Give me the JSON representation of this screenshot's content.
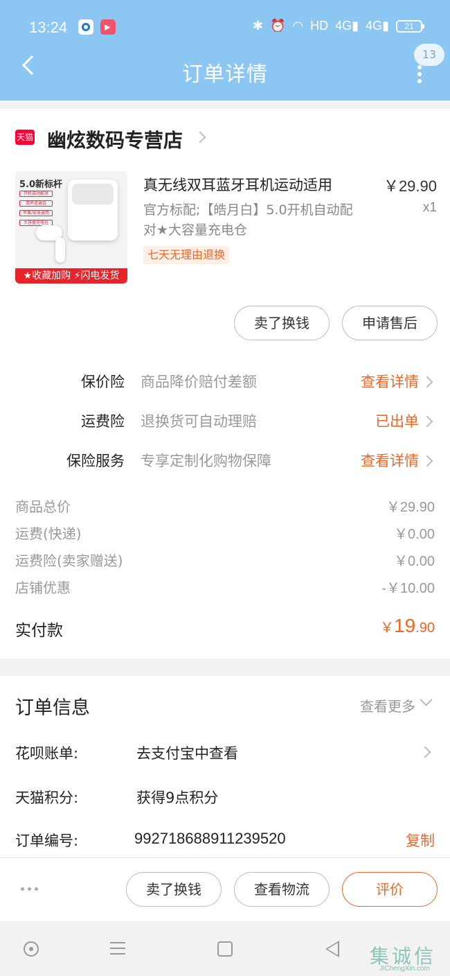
{
  "status_bar": {
    "time": "13:24",
    "network": "HD",
    "signal1": "4G",
    "signal2": "4G",
    "battery": "21"
  },
  "header": {
    "title": "订单详情",
    "badge": "13"
  },
  "store": {
    "tag": "天猫",
    "name": "幽炫数码专营店"
  },
  "product": {
    "image_headline": "5.0新标杆",
    "image_lines": [
      "开机自动配对",
      "双声道通话",
      "苹果/安卓通用",
      "大容量充电仓"
    ],
    "image_banner": "★收藏加购 ⚡闪电发货",
    "title": "真无线双耳蓝牙耳机运动适用",
    "price": "￥29.90",
    "sku": "官方标配;【皓月白】5.0开机自动配对★大容量充电仓",
    "qty": "x1",
    "tag": "七天无理由退换"
  },
  "item_buttons": {
    "sell": "卖了换钱",
    "after_sale": "申请售后"
  },
  "insurance": [
    {
      "name": "保价险",
      "desc": "商品降价赔付差额",
      "action": "查看详情"
    },
    {
      "name": "运费险",
      "desc": "退换货可自动理赔",
      "action": "已出单"
    },
    {
      "name": "保险服务",
      "desc": "专享定制化购物保障",
      "action": "查看详情"
    }
  ],
  "costs": [
    {
      "label": "商品总价",
      "value": "￥29.90"
    },
    {
      "label": "运费(快递)",
      "value": "￥0.00"
    },
    {
      "label": "运费险(卖家赠送)",
      "value": "￥0.00"
    },
    {
      "label": "店铺优惠",
      "value": "-￥10.00"
    }
  ],
  "paid": {
    "label": "实付款",
    "currency": "￥",
    "integer": "19",
    "decimal": ".90"
  },
  "order_info": {
    "title": "订单信息",
    "more": "查看更多",
    "rows": [
      {
        "label": "花呗账单:",
        "value": "去支付宝中查看"
      },
      {
        "label": "天猫积分:",
        "value": "获得9点积分"
      },
      {
        "label": "订单编号:",
        "value": "992718688911239520",
        "action": "复制"
      }
    ]
  },
  "bottom_bar": {
    "sell": "卖了换钱",
    "logistics": "查看物流",
    "rate": "评价"
  },
  "watermark": {
    "text": "集诚信",
    "url": "JiChengXin.com"
  },
  "colors": {
    "header": "#8cc6f3",
    "accent": "#f26522",
    "tmall": "#ff0036"
  }
}
